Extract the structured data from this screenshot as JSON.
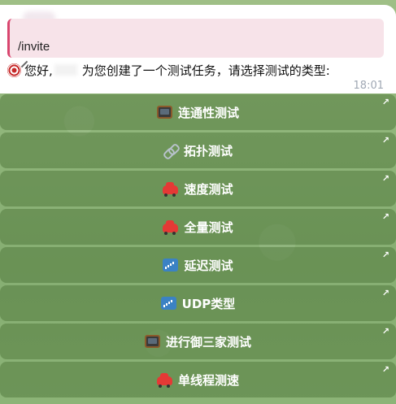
{
  "message": {
    "reply_text": "/invite",
    "greeting": "您好,",
    "body": "为您创建了一个测试任务，请选择测试的类型:",
    "time": "18:01"
  },
  "keyboard": {
    "buttons": [
      {
        "icon": "tv-icon",
        "label": "连通性测试",
        "arrow": "↗"
      },
      {
        "icon": "link-icon",
        "label": "拓扑测试",
        "arrow": "↗"
      },
      {
        "icon": "car-icon",
        "label": "速度测试",
        "arrow": "↗"
      },
      {
        "icon": "car-icon",
        "label": "全量测试",
        "arrow": "↗"
      },
      {
        "icon": "signal-icon",
        "label": "延迟测试",
        "arrow": "↗"
      },
      {
        "icon": "signal-icon",
        "label": "UDP类型",
        "arrow": "↗"
      },
      {
        "icon": "tv-icon",
        "label": "进行御三家测试",
        "arrow": "↗"
      },
      {
        "icon": "car-icon",
        "label": "单线程测速",
        "arrow": "↗"
      }
    ]
  }
}
